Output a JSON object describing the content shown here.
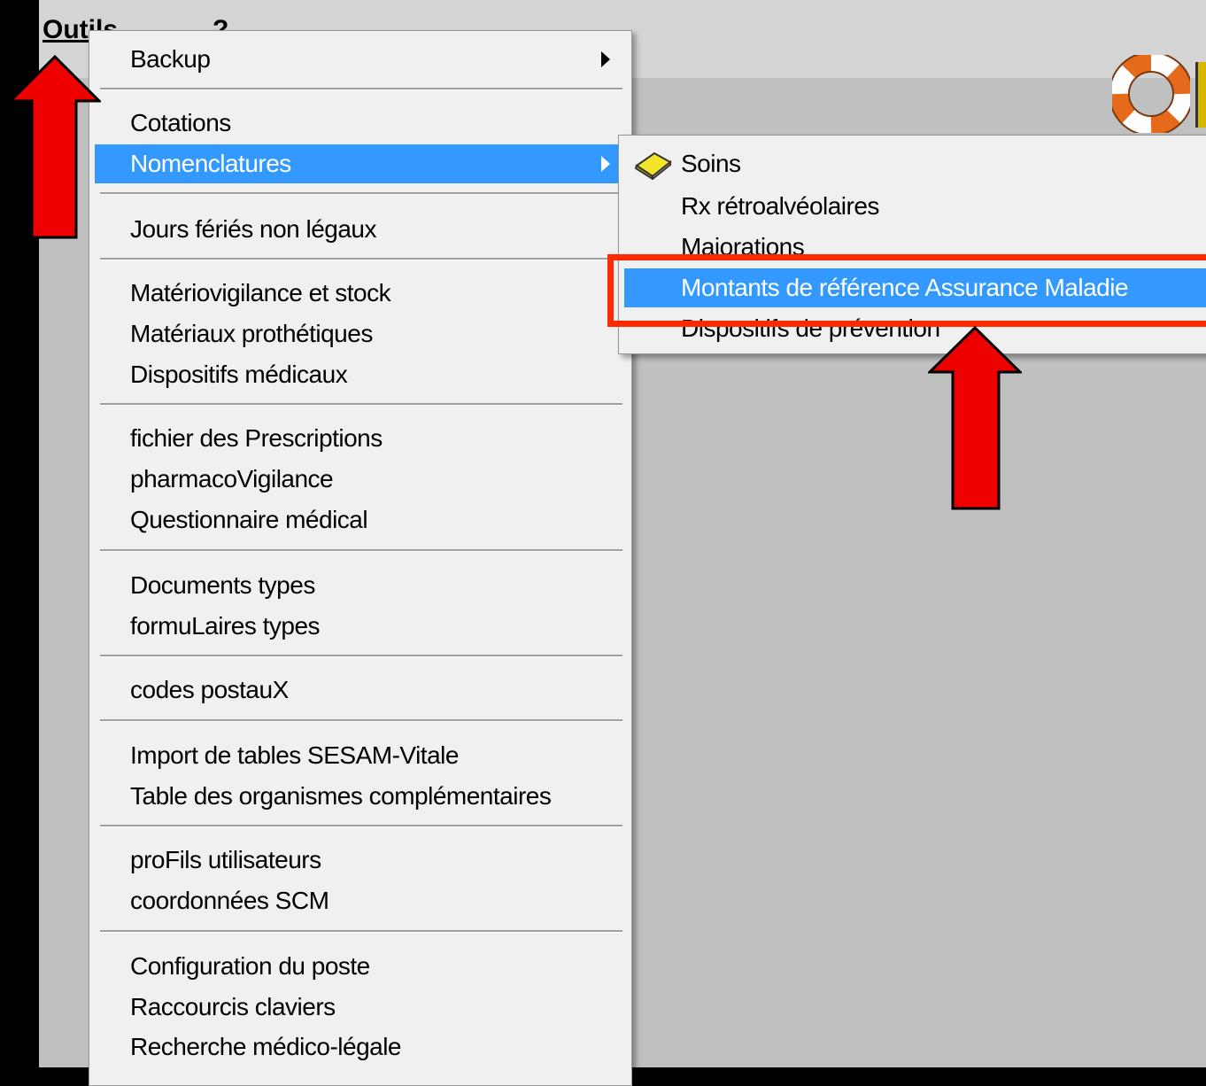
{
  "menubar": {
    "outils": "Outils",
    "help": "?"
  },
  "main_menu": {
    "items": [
      {
        "label": "Backup",
        "submenu": true
      },
      {
        "label": "Cotations"
      },
      {
        "label": "Nomenclatures",
        "submenu": true,
        "highlighted": true
      },
      {
        "label": "Jours fériés non légaux"
      },
      {
        "label": "Matériovigilance et stock"
      },
      {
        "label": "Matériaux prothétiques"
      },
      {
        "label": "Dispositifs médicaux"
      },
      {
        "label": "fichier des Prescriptions"
      },
      {
        "label": "pharmacoVigilance"
      },
      {
        "label": "Questionnaire médical"
      },
      {
        "label": "Documents types"
      },
      {
        "label": "formuLaires types"
      },
      {
        "label": "codes postauX"
      },
      {
        "label": "Import de tables SESAM-Vitale"
      },
      {
        "label": "Table des organismes complémentaires"
      },
      {
        "label": "proFils utilisateurs"
      },
      {
        "label": "coordonnées SCM"
      },
      {
        "label": "Configuration du poste"
      },
      {
        "label": "Raccourcis claviers"
      },
      {
        "label": "Recherche médico-légale"
      }
    ]
  },
  "sub_menu": {
    "items": [
      {
        "label": "Soins",
        "icon": "book-icon"
      },
      {
        "label": "Rx rétroalvéolaires"
      },
      {
        "label": "Majorations"
      },
      {
        "label": "Montants de référence Assurance Maladie",
        "highlighted": true
      },
      {
        "label": "Dispositifs de prévention"
      }
    ]
  },
  "colors": {
    "highlight": "#3399ff",
    "annotation_red": "#ff2a00",
    "arrow_red": "#ee0000"
  }
}
